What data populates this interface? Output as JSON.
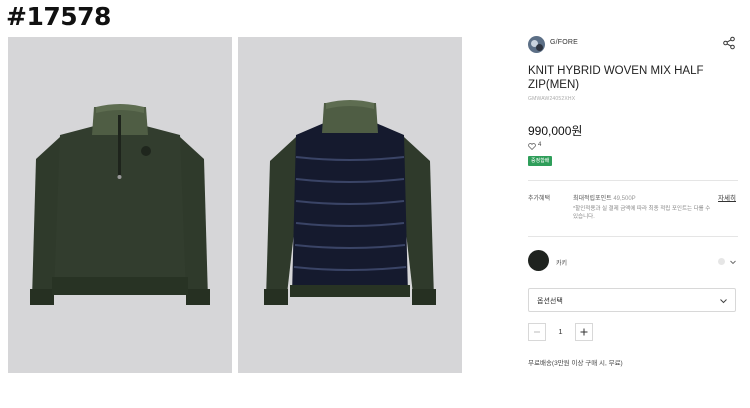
{
  "watermark": "#17578",
  "brand": {
    "name": "G/FORE"
  },
  "product": {
    "title": "KNIT HYBRID WOVEN MIX HALF ZIP(MEN)",
    "code": "GMWAW24052XHX",
    "price": "990,000원",
    "like_count": "4",
    "badge": "증정합배"
  },
  "points": {
    "label": "추가혜택",
    "text": "최대적립포인트",
    "value": "49,500P",
    "detail_link": "자세히",
    "note": "*할인적용과 실 결제 금액에 따라 최종 적립 포인트는 다를 수 있습니다."
  },
  "color_option": {
    "name": "카키",
    "swatch_color": "#1f231f"
  },
  "option_select": {
    "placeholder": "옵션선택"
  },
  "quantity": {
    "value": "1"
  },
  "shipping_note": "무료배송(3만원 이상 구매 시, 무료)",
  "colors": {
    "accent_badge": "#2f9e5a",
    "photo_bg": "#d6d6d8"
  },
  "icons": [
    "share-icon",
    "heart-icon",
    "chevron-down-icon",
    "minus-icon",
    "plus-icon"
  ]
}
